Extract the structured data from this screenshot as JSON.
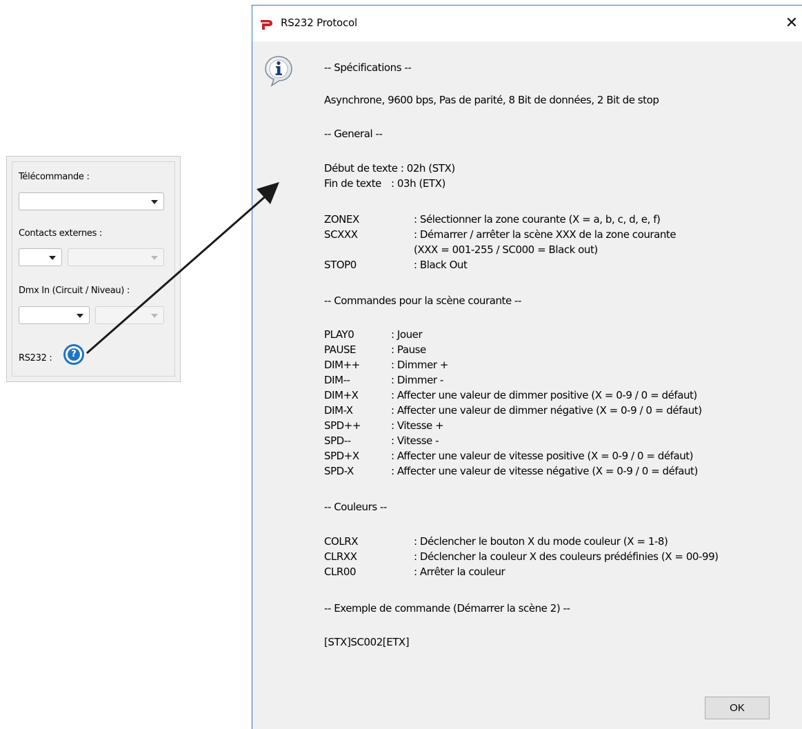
{
  "left_panel": {
    "telecommande_label": "Télécommande :",
    "contacts_label": "Contacts externes :",
    "dmx_label": "Dmx In (Circuit / Niveau) :",
    "rs232_label": "RS232 :",
    "help_icon": "help-circle-icon"
  },
  "dialog": {
    "title": "RS232 Protocol",
    "app_icon": "red-pipe-logo-icon",
    "info_icon": "information-balloon-icon",
    "close_glyph": "✕",
    "ok_label": "OK",
    "sections": {
      "spec_header": "-- Spécifications --",
      "spec_text": "Asynchrone, 9600 bps, Pas de parité, 8 Bit de données, 2 Bit de stop",
      "general_header": "-- General --",
      "start_text": "Début de texte : 02h (STX)",
      "end_text_key": "Fin de texte",
      "end_text_val": ": 03h (ETX)",
      "general_cmds": [
        {
          "cmd": "ZONEX",
          "desc": ": Sélectionner la zone courante (X = a, b, c, d, e, f)"
        },
        {
          "cmd": "SCXXX",
          "desc": ": Démarrer / arrêter la scène XXX de la zone courante"
        },
        {
          "cmd": "",
          "desc": " (XXX = 001-255 / SC000 = Black out)"
        },
        {
          "cmd": "STOP0",
          "desc": ": Black Out"
        }
      ],
      "scene_header": "-- Commandes pour la scène courante --",
      "scene_cmds": [
        {
          "cmd": "PLAY0",
          "desc": ": Jouer"
        },
        {
          "cmd": "PAUSE",
          "desc": ": Pause"
        },
        {
          "cmd": "DIM++",
          "desc": ": Dimmer +"
        },
        {
          "cmd": "DIM--",
          "desc": ": Dimmer -"
        },
        {
          "cmd": "DIM+X",
          "desc": ": Affecter une valeur de dimmer positive (X = 0-9 / 0 = défaut)"
        },
        {
          "cmd": "DIM-X",
          "desc": ": Affecter une valeur de dimmer négative (X = 0-9 / 0 = défaut)"
        },
        {
          "cmd": "SPD++",
          "desc": ": Vitesse +"
        },
        {
          "cmd": "SPD--",
          "desc": ": Vitesse -"
        },
        {
          "cmd": "SPD+X",
          "desc": ": Affecter une valeur de vitesse positive (X = 0-9 / 0 = défaut)"
        },
        {
          "cmd": "SPD-X",
          "desc": ": Affecter une valeur de vitesse négative (X = 0-9 / 0 = défaut)"
        }
      ],
      "color_header": "-- Couleurs --",
      "color_cmds": [
        {
          "cmd": "COLRX",
          "desc": ": Déclencher le bouton X du mode couleur (X = 1-8)"
        },
        {
          "cmd": "CLRXX",
          "desc": ": Déclencher la couleur X des couleurs prédéfinies (X = 00-99)"
        },
        {
          "cmd": "CLR00",
          "desc": ": Arrêter la couleur"
        }
      ],
      "example_header": "-- Exemple de commande (Démarrer la scène 2) --",
      "example_text": "[STX]SC002[ETX]"
    }
  },
  "colors": {
    "accent_blue": "#1e74c4",
    "dialog_border": "#2b78c5",
    "arrow": "#1a1a1a"
  }
}
